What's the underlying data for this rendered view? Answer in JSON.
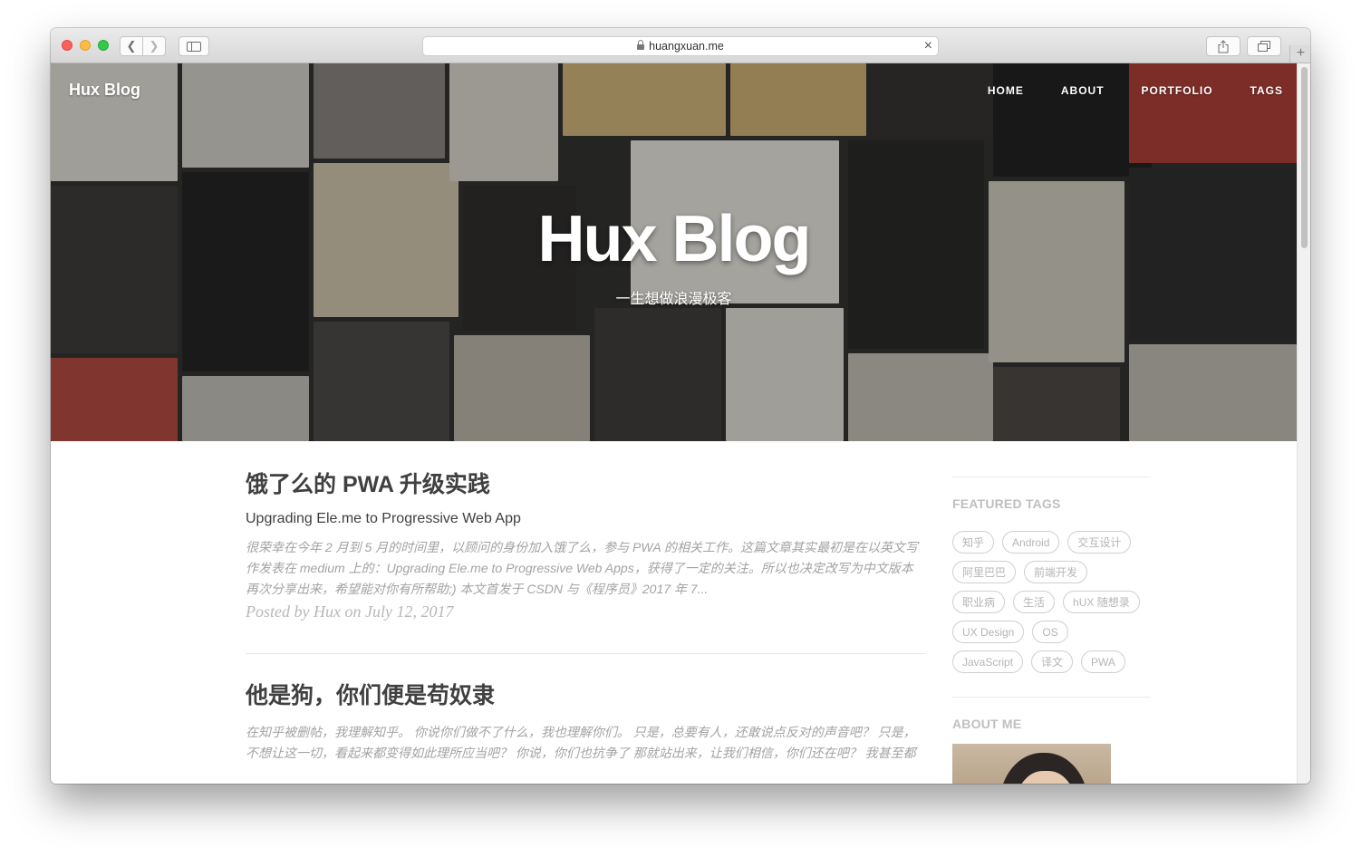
{
  "browser": {
    "url": "huangxuan.me"
  },
  "site": {
    "brand": "Hux Blog",
    "nav": [
      "HOME",
      "ABOUT",
      "PORTFOLIO",
      "TAGS"
    ],
    "hero_title": "Hux Blog",
    "hero_subtitle": "一生想做浪漫极客"
  },
  "posts": [
    {
      "title": "饿了么的 PWA 升级实践",
      "subtitle": "Upgrading Ele.me to Progressive Web App",
      "excerpt": "很荣幸在今年 2 月到 5 月的时间里，以顾问的身份加入饿了么，参与 PWA 的相关工作。这篇文章其实最初是在以英文写作发表在 medium 上的：Upgrading Ele.me to Progressive Web Apps，获得了一定的关注。所以也决定改写为中文版本再次分享出来，希望能对你有所帮助;) 本文首发于 CSDN 与《程序员》2017 年 7...",
      "meta": "Posted by Hux on July 12, 2017"
    },
    {
      "title": "他是狗，你们便是苟奴隶",
      "excerpt": "在知乎被删帖，我理解知乎。 你说你们做不了什么，我也理解你们。 只是，总要有人，还敢说点反对的声音吧？ 只是，不想让这一切，看起来都变得如此理所应当吧？ 你说，你们也抗争了 那就站出来，让我们相信，你们还在吧？ 我甚至都"
    }
  ],
  "sidebar": {
    "featured_tags_heading": "FEATURED TAGS",
    "tags": [
      "知乎",
      "Android",
      "交互设计",
      "阿里巴巴",
      "前端开发",
      "职业病",
      "生活",
      "hUX 随想录",
      "UX Design",
      "OS",
      "JavaScript",
      "译文",
      "PWA"
    ],
    "about_heading": "ABOUT ME"
  }
}
